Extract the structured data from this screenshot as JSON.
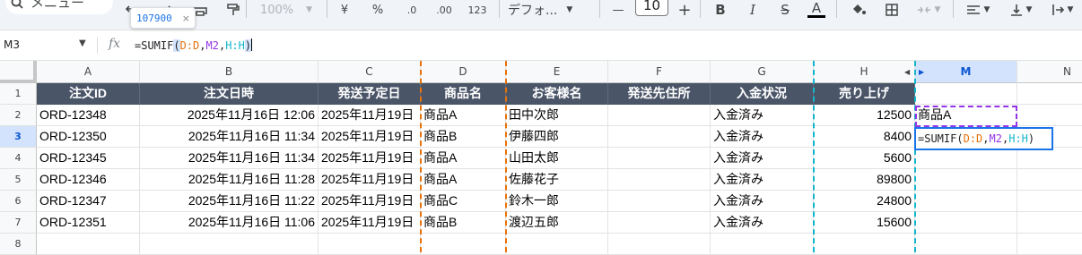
{
  "toolbar": {
    "menu_label": "メニュー",
    "zoom": "100%",
    "currency": "¥",
    "percent": "%",
    "dec_decrease": ".0",
    "dec_increase": ".00",
    "number_format": "123",
    "font_family": "デフォ...",
    "font_size": "10",
    "minus": "—",
    "plus": "+",
    "bold": "B",
    "italic": "I",
    "strike": "S",
    "text_color": "A"
  },
  "tooltip": {
    "value": "107900",
    "close": "×"
  },
  "formula_bar": {
    "name_box": "M3",
    "fx": "fx",
    "formula": {
      "prefix": "=SUMIF",
      "open": "(",
      "arg1": "D:D",
      "comma1": ",",
      "arg2": "M2",
      "comma2": ",",
      "arg3": "H:H",
      "close": ")"
    }
  },
  "columns": [
    "A",
    "B",
    "C",
    "D",
    "E",
    "F",
    "G",
    "H",
    "M",
    "N"
  ],
  "rows": [
    "1",
    "2",
    "3",
    "4",
    "5",
    "6",
    "7",
    "8"
  ],
  "selected_cell": "M3",
  "headers": [
    "注文ID",
    "注文日時",
    "発送予定日",
    "商品名",
    "お客様名",
    "発送先住所",
    "入金状況",
    "売り上げ"
  ],
  "table": [
    [
      "ORD-12348",
      "2025年11月16日 12:06",
      "2025年11月19日",
      "商品A",
      "田中次郎",
      "",
      "入金済み",
      "12500"
    ],
    [
      "ORD-12350",
      "2025年11月16日 11:34",
      "2025年11月19日",
      "商品B",
      "伊藤四郎",
      "",
      "入金済み",
      "8400"
    ],
    [
      "ORD-12345",
      "2025年11月16日 11:34",
      "2025年11月19日",
      "商品A",
      "山田太郎",
      "",
      "入金済み",
      "5600"
    ],
    [
      "ORD-12346",
      "2025年11月16日 11:28",
      "2025年11月19日",
      "商品A",
      "佐藤花子",
      "",
      "入金済み",
      "89800"
    ],
    [
      "ORD-12347",
      "2025年11月16日 11:22",
      "2025年11月19日",
      "商品C",
      "鈴木一郎",
      "",
      "入金済み",
      "24800"
    ],
    [
      "ORD-12351",
      "2025年11月16日 11:06",
      "2025年11月19日",
      "商品B",
      "渡辺五郎",
      "",
      "入金済み",
      "15600"
    ]
  ],
  "m2_value": "商品A",
  "colors": {
    "header_bg": "#4a5568",
    "range_d": "#e8710a",
    "range_m": "#9334e6",
    "range_h": "#12b5cb",
    "selection": "#1a73e8"
  }
}
